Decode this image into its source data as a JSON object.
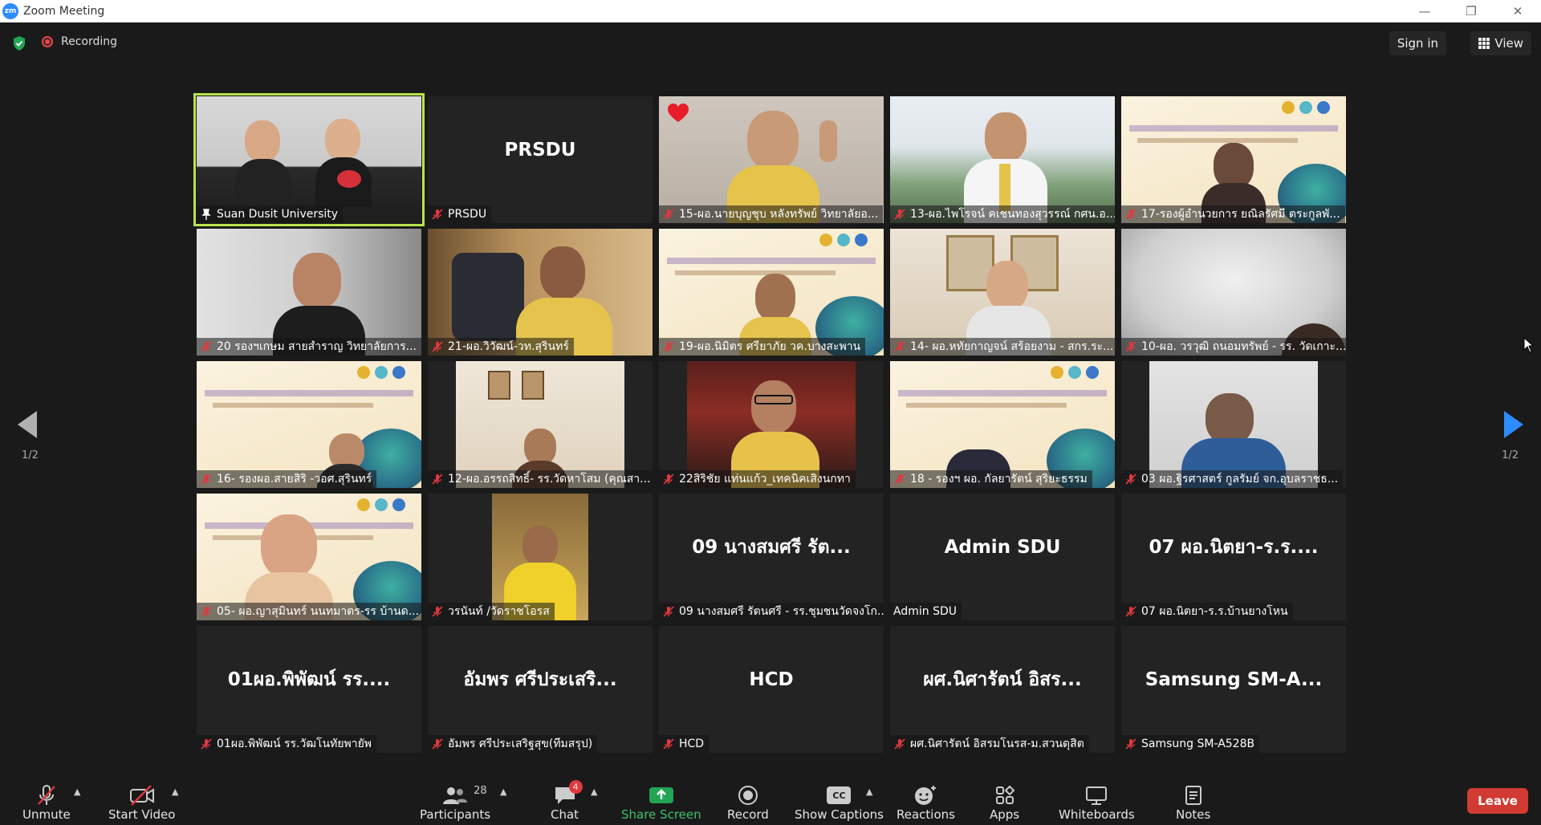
{
  "window": {
    "title": "Zoom Meeting",
    "logo_text": "zm"
  },
  "topbar": {
    "recording_label": "Recording",
    "signin_label": "Sign in",
    "view_label": "View"
  },
  "pagination": {
    "left": "1/2",
    "right": "1/2"
  },
  "tiles": [
    {
      "name": "Suan Dusit University"
    },
    {
      "name": "PRSDU",
      "big": "PRSDU"
    },
    {
      "name": "15-ผอ.นายบุญชุบ หลังทรัพย์ วิทยาลัยอ..."
    },
    {
      "name": "13-ผอ.ไพโรจน์ คเชนทองสุวรรณ์ กศน.อ..."
    },
    {
      "name": "17-รองผู้อำนวยการ ยณิลรัศมี ตระกูลพั..."
    },
    {
      "name": "20 รองฯเกษม สายสำราญ  วิทยาลัยการ..."
    },
    {
      "name": "21-ผอ.วิวัฒน์-วท.สุรินทร์"
    },
    {
      "name": "19-ผอ.นิมิตร ศรียาภัย  วค.บางสะพาน"
    },
    {
      "name": "14- ผอ.หทัยกาญจน์ สร้อยงาม - สกร.ระ..."
    },
    {
      "name": "10-ผอ. วรวุฒิ ถนอมทรัพย์ - รร. วัดเกาะ..."
    },
    {
      "name": "16- รองผอ.สายสิริ -วอศ.สุรินทร์"
    },
    {
      "name": "12-ผอ.อรรถสิทธิ์- รร.วัดหาโสม (คุณสา..."
    },
    {
      "name": "22สิริชัย แท่นแก้ว_เทคนิคเสิงนกทา"
    },
    {
      "name": "18 - รองฯ ผอ. กัลยารัตน์  สุริยะธรรม"
    },
    {
      "name": "03 ผอ.ฐิรศาสตร์ กูลรัมย์  จก.อุบลราชธ..."
    },
    {
      "name": "05- ผอ.ญาสุมินทร์ นนทมาตร-รร บ้านด..."
    },
    {
      "name": "วรนันท์ /วัดราชโอรส"
    },
    {
      "name": "09 นางสมศรี รัตนศรี - รร.ชุมชนวัดจงโก...",
      "big": "09 นางสมศรี รัต..."
    },
    {
      "name": "Admin SDU",
      "big": "Admin SDU"
    },
    {
      "name": "07 ผอ.นิตยา-ร.ร.บ้านยางโหน",
      "big": "07 ผอ.นิตยา-ร.ร...."
    },
    {
      "name": "01ผอ.พิพัฒน์ รร.วัฒโนทัยพายัพ",
      "big": "01ผอ.พิพัฒน์ รร...."
    },
    {
      "name": "อัมพร ศรีประเสริฐสุข(ทีมสรุป)",
      "big": "อัมพร ศรีประเสริ..."
    },
    {
      "name": "HCD",
      "big": "HCD"
    },
    {
      "name": "ผศ.นิศารัตน์ อิสรมโนรส-ม.สวนดุสิต",
      "big": "ผศ.นิศารัตน์ อิสร..."
    },
    {
      "name": "Samsung SM-A528B",
      "big": "Samsung  SM-A..."
    }
  ],
  "toolbar": {
    "unmute": "Unmute",
    "start_video": "Start Video",
    "participants": "Participants",
    "participants_count": "28",
    "chat": "Chat",
    "chat_badge": "4",
    "share_screen": "Share Screen",
    "record": "Record",
    "captions": "Show Captions",
    "captions_icon_text": "CC",
    "reactions": "Reactions",
    "apps": "Apps",
    "whiteboards": "Whiteboards",
    "notes": "Notes",
    "leave": "Leave"
  },
  "colors": {
    "accent": "#2d8cff",
    "active_speaker": "#b8e34a",
    "leave": "#d13b32",
    "share": "#23a455"
  }
}
